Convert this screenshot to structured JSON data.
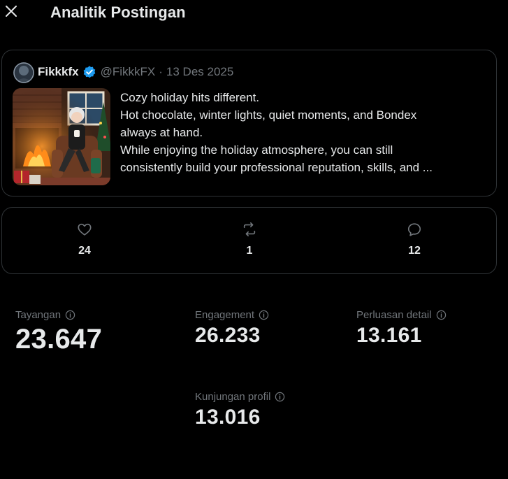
{
  "header": {
    "title": "Analitik Postingan",
    "close_icon": "close-icon"
  },
  "post": {
    "author_name": "Fikkkfx",
    "handle": "@FikkkFX",
    "separator": "·",
    "date": "13 Des 2025",
    "verified_color": "#1d9bf0",
    "text_lines": [
      "Cozy holiday hits different.",
      "Hot chocolate, winter lights, quiet moments, and Bondex",
      "always at hand.",
      "While enjoying the holiday atmosphere, you can still",
      "consistently build your professional reputation, skills, and ..."
    ]
  },
  "engagement": {
    "likes": {
      "icon": "heart-icon",
      "count": "24"
    },
    "reposts": {
      "icon": "repost-icon",
      "count": "1"
    },
    "replies": {
      "icon": "reply-icon",
      "count": "12"
    }
  },
  "metrics": {
    "impressions": {
      "label": "Tayangan",
      "value": "23.647"
    },
    "engagements": {
      "label": "Engagement",
      "value": "26.233"
    },
    "detail_expands": {
      "label": "Perluasan detail",
      "value": "13.161"
    },
    "profile_visits": {
      "label": "Kunjungan profil",
      "value": "13.016"
    }
  },
  "colors": {
    "background": "#000000",
    "primary_text": "#e7e9ea",
    "secondary_text": "#71767b",
    "border": "#2f3336",
    "accent": "#1d9bf0"
  }
}
